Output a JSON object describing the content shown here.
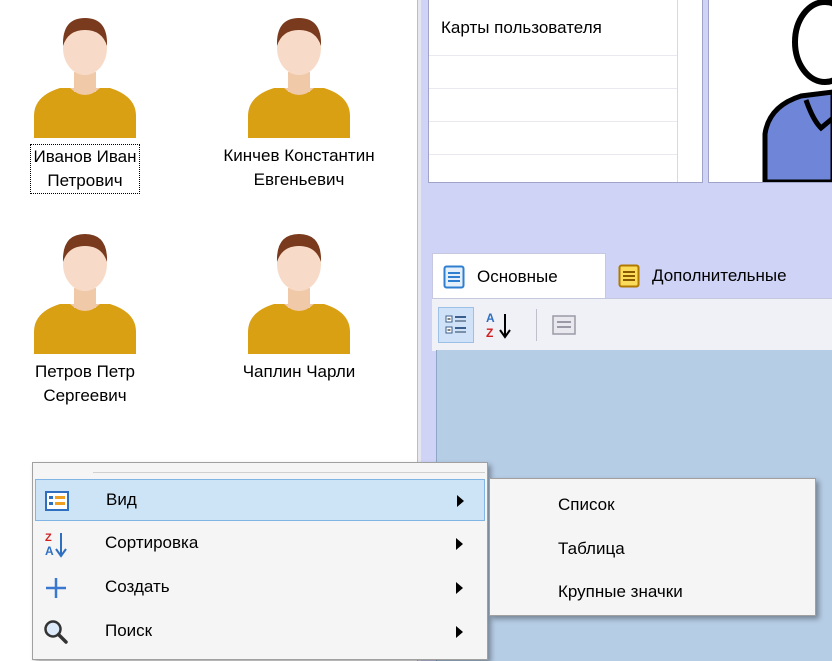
{
  "users": [
    {
      "name": "Иванов Иван\nПетрович",
      "selected": true
    },
    {
      "name": "Кинчев Константин\nЕвгеньевич",
      "selected": false
    },
    {
      "name": "Петров Петр\nСергеевич",
      "selected": false
    },
    {
      "name": "Чаплин Чарли",
      "selected": false
    }
  ],
  "cards": {
    "header": "Карты пользователя"
  },
  "tabs": [
    {
      "label": "Основные",
      "icon": "list-icon"
    },
    {
      "label": "Дополнительные",
      "icon": "notes-icon"
    }
  ],
  "toolbar": {
    "icons": [
      "categorized-icon",
      "sort-az-icon",
      "property-pages-icon"
    ]
  },
  "context_menu": {
    "items": [
      {
        "label": "Вид",
        "icon": "view-icon",
        "has_submenu": true,
        "highlighted": true
      },
      {
        "label": "Сортировка",
        "icon": "sort-icon",
        "has_submenu": true
      },
      {
        "label": "Создать",
        "icon": "plus-icon",
        "has_submenu": true
      },
      {
        "label": "Поиск",
        "icon": "search-icon",
        "has_submenu": true
      }
    ]
  },
  "view_submenu": {
    "items": [
      "Список",
      "Таблица",
      "Крупные значки"
    ]
  },
  "colors": {
    "panel_background": "#cfd3f5",
    "property_area": "#b6cde6",
    "menu_highlight": "#cde4f7",
    "avatar_shirt": "#d9a014",
    "avatar_hair": "#7a3a1e",
    "avatar_skin": "#f7dbc8"
  }
}
